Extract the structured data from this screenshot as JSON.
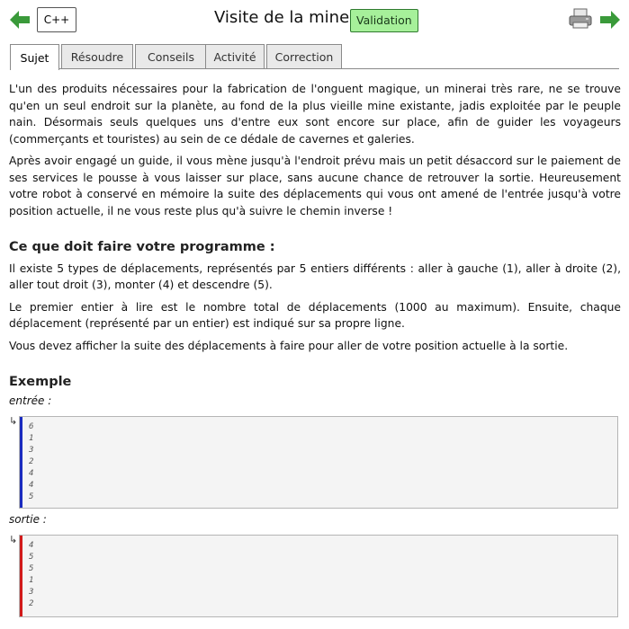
{
  "header": {
    "language_label": "C++",
    "title": "Visite de la mine",
    "validation_label": "Validation"
  },
  "tabs": [
    {
      "label": "Sujet"
    },
    {
      "label": "Résoudre"
    },
    {
      "label": "Conseils"
    },
    {
      "label": "Activité"
    },
    {
      "label": "Correction"
    }
  ],
  "body": {
    "p1": "L'un des produits nécessaires pour la fabrication de l'onguent magique, un minerai très rare, ne se trouve qu'en un seul endroit sur la planète, au fond de la plus vieille mine existante, jadis exploitée par le peuple nain. Désormais seuls quelques uns d'entre eux sont encore sur place, afin de guider les voyageurs (commerçants et touristes) au sein de ce dédale de cavernes et galeries.",
    "p2": "Après avoir engagé un guide, il vous mène jusqu'à l'endroit prévu mais un petit désaccord sur le paiement de ses services le pousse à vous laisser sur place, sans aucune chance de retrouver la sortie. Heureusement votre robot à conservé en mémoire la suite des déplacements qui vous ont amené de l'entrée jusqu'à votre position actuelle, il ne vous reste plus qu'à suivre le chemin inverse !",
    "heading_task": "Ce que doit faire votre programme :",
    "p3": "Il existe 5 types de déplacements, représentés par 5 entiers différents : aller à gauche (1), aller à droite (2), aller tout droit (3), monter (4) et descendre (5).",
    "p4": "Le premier entier à lire est le nombre total de déplacements (1000 au maximum). Ensuite, chaque déplacement (représenté par un entier) est indiqué sur sa propre ligne.",
    "p5": "Vous devez afficher la suite des déplacements à faire pour aller de votre position actuelle à la sortie.",
    "heading_example": "Exemple",
    "input_label": "entrée :",
    "output_label": "sortie :"
  },
  "example": {
    "input_lines": [
      "6",
      "1",
      "3",
      "2",
      "4",
      "4",
      "5"
    ],
    "output_lines": [
      "4",
      "5",
      "5",
      "1",
      "3",
      "2"
    ]
  },
  "colors": {
    "input_bar": "#1a2bbf",
    "output_bar": "#d11a1a",
    "nav_arrow": "#3a9a3a",
    "validation_bg": "#a6f09a"
  }
}
